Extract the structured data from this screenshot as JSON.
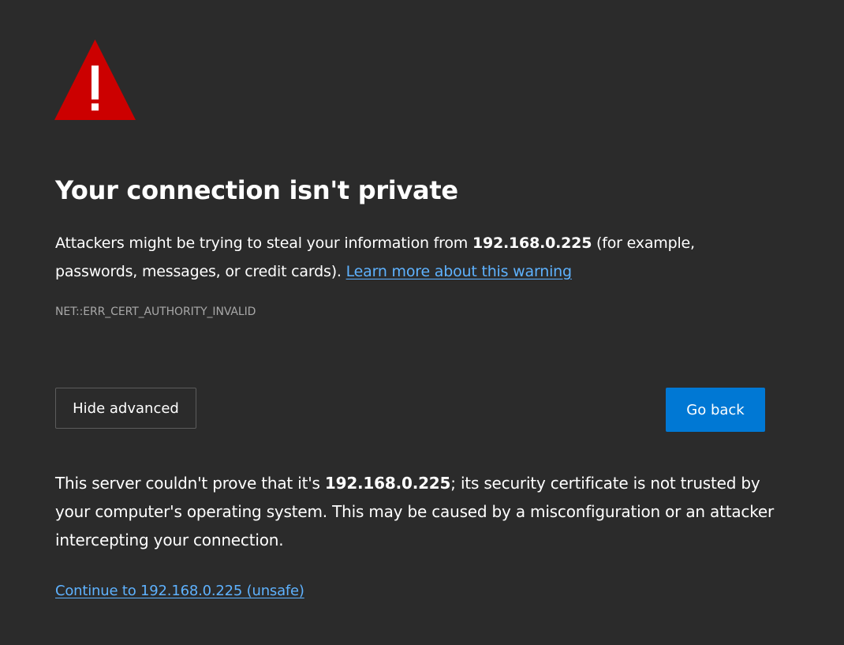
{
  "icon": {
    "name": "warning-triangle-icon",
    "color": "#cc0000"
  },
  "heading": {
    "title": "Your connection isn't private"
  },
  "intro": {
    "prefix": "Attackers might be trying to steal your information from ",
    "host": "192.168.0.225",
    "suffix": " (for example, passwords, messages, or credit cards). ",
    "learn_more": "Learn more about this warning"
  },
  "error_code": "NET::ERR_CERT_AUTHORITY_INVALID",
  "buttons": {
    "hide_advanced": "Hide advanced",
    "go_back": "Go back"
  },
  "advanced": {
    "prefix": "This server couldn't prove that it's ",
    "host": "192.168.0.225",
    "suffix": "; its security certificate is not trusted by your computer's operating system. This may be caused by a misconfiguration or an attacker intercepting your connection.",
    "continue_link": "Continue to 192.168.0.225 (unsafe)"
  },
  "colors": {
    "background": "#2b2b2b",
    "link": "#5eb2ff",
    "primary_button": "#0078d4",
    "muted_text": "#a8a8a8"
  }
}
